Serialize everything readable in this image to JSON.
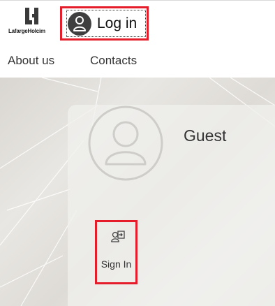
{
  "header": {
    "logo_text": "LafargeHolcim",
    "login_label": "Log in"
  },
  "nav": {
    "items": [
      "About us",
      "Contacts"
    ]
  },
  "profile_card": {
    "name": "Guest",
    "sign_in_label": "Sign In"
  },
  "colors": {
    "highlight": "#e51d2b",
    "avatar_dark": "#3f3f3f"
  }
}
